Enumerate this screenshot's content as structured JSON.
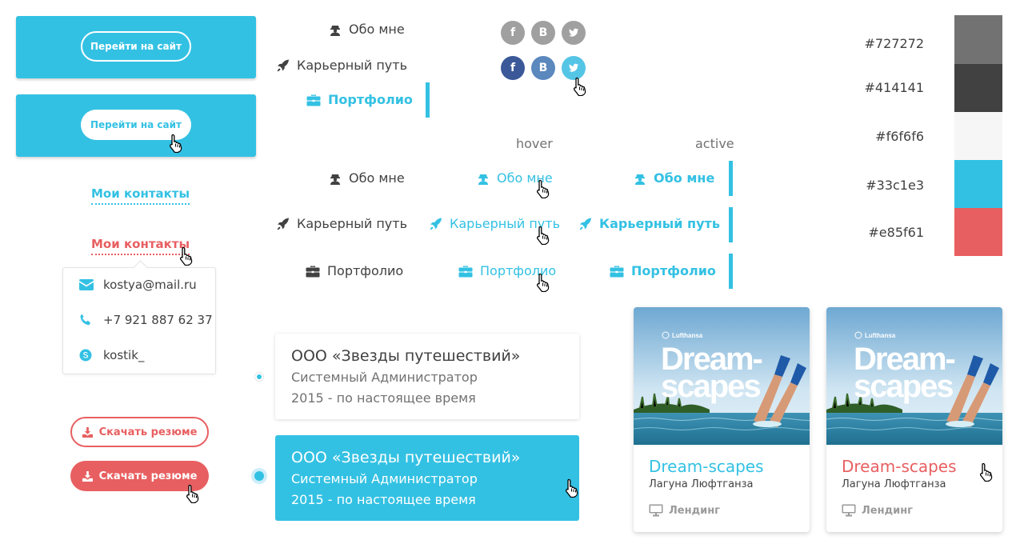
{
  "site_buttons": {
    "outline_label": "Перейти на сайт",
    "filled_label": "Перейти на сайт"
  },
  "contacts": {
    "link_default": "Мои контакты",
    "link_hover": "Мои контакты",
    "email": "kostya@mail.ru",
    "phone": "+7 921 887 62 37",
    "skype": "kostik_"
  },
  "download": {
    "outline_label": "Скачать резюме",
    "filled_label": "Скачать резюме"
  },
  "nav_top": [
    {
      "label": "Обо мне",
      "icon": "user-icon"
    },
    {
      "label": "Карьерный путь",
      "icon": "rocket-icon"
    },
    {
      "label": "Портфолио",
      "icon": "briefcase-icon"
    }
  ],
  "states": {
    "hover": "hover",
    "active": "active"
  },
  "nav_states": {
    "default": [
      "Обо мне",
      "Карьерный путь",
      "Портфолио"
    ],
    "hover": [
      "Обо мне",
      "Карьерный путь",
      "Портфолио"
    ],
    "active": [
      "Обо мне",
      "Карьерный путь",
      "Портфолио"
    ]
  },
  "social": {
    "icons": [
      "facebook-icon",
      "vk-icon",
      "twitter-icon"
    ],
    "fb_letter": "f",
    "vk_letter": "B",
    "gray": "#a0a0a0",
    "fb_color": "#3b5998",
    "vk_color": "#5b88bd",
    "tw_color": "#55c5e6"
  },
  "jobs": [
    {
      "company": "ООО «Звезды путешествий»",
      "role": "Системный Администратор",
      "period": "2015 - по настоящее время"
    },
    {
      "company": "ООО «Звезды путешествий»",
      "role": "Системный Администратор",
      "period": "2015 - по настоящее время"
    }
  ],
  "palette": [
    {
      "code": "#727272",
      "color": "#727272"
    },
    {
      "code": "#414141",
      "color": "#414141"
    },
    {
      "code": "#f6f6f6",
      "color": "#f6f6f6"
    },
    {
      "code": "#33c1e3",
      "color": "#33c1e3"
    },
    {
      "code": "#e85f61",
      "color": "#e85f61"
    }
  ],
  "portfolio": [
    {
      "title": "Dream-scapes",
      "subtitle": "Лагуна Люфтганза",
      "tag": "Лендинг",
      "brand": "Lufthansa",
      "headline1": "Dream-",
      "headline2": "scapes"
    },
    {
      "title": "Dream-scapes",
      "subtitle": "Лагуна Люфтганза",
      "tag": "Лендинг",
      "brand": "Lufthansa",
      "headline1": "Dream-",
      "headline2": "scapes"
    }
  ]
}
